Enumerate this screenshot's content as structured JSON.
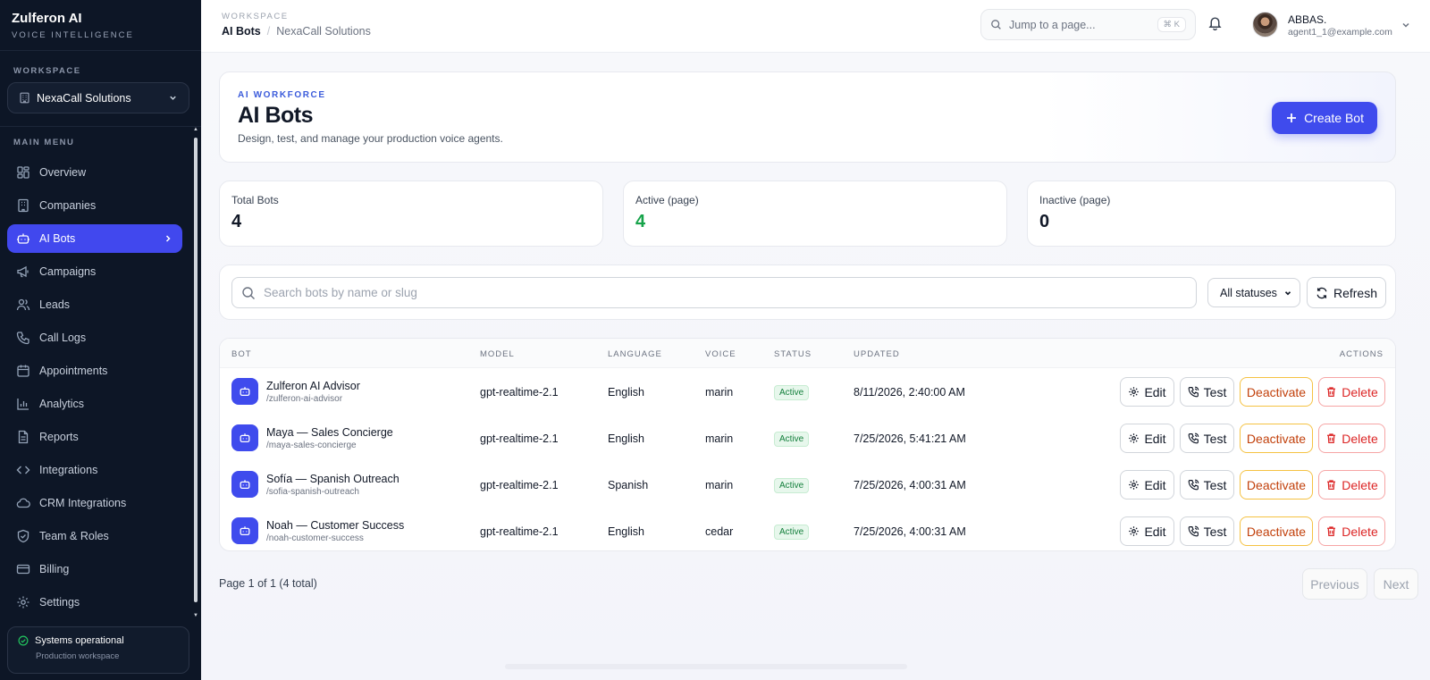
{
  "brand": {
    "name": "Zulferon AI",
    "subtitle": "VOICE INTELLIGENCE"
  },
  "workspace": {
    "label": "WORKSPACE",
    "selected": "NexaCall Solutions"
  },
  "menu": {
    "label": "MAIN MENU",
    "items": [
      {
        "label": "Overview",
        "icon": "overview-icon"
      },
      {
        "label": "Companies",
        "icon": "companies-icon"
      },
      {
        "label": "AI Bots",
        "icon": "bot-icon",
        "active": true
      },
      {
        "label": "Campaigns",
        "icon": "megaphone-icon"
      },
      {
        "label": "Leads",
        "icon": "users-icon"
      },
      {
        "label": "Call Logs",
        "icon": "phone-icon"
      },
      {
        "label": "Appointments",
        "icon": "calendar-icon"
      },
      {
        "label": "Analytics",
        "icon": "bar-chart-icon"
      },
      {
        "label": "Reports",
        "icon": "document-icon"
      },
      {
        "label": "Integrations",
        "icon": "code-icon"
      },
      {
        "label": "CRM Integrations",
        "icon": "cloud-icon"
      },
      {
        "label": "Team & Roles",
        "icon": "shield-icon"
      },
      {
        "label": "Billing",
        "icon": "credit-card-icon"
      },
      {
        "label": "Settings",
        "icon": "gear-icon"
      }
    ]
  },
  "system_status": {
    "title": "Systems operational",
    "subtitle": "Production workspace"
  },
  "topbar": {
    "crumb_label": "WORKSPACE",
    "crumb_current": "AI Bots",
    "crumb_separator": "/",
    "crumb_workspace": "NexaCall Solutions",
    "jump_placeholder": "Jump to a page...",
    "jump_shortcut": "⌘ K",
    "user_name": "ABBAS.",
    "user_email": "agent1_1@example.com"
  },
  "hero": {
    "eyebrow": "AI WORKFORCE",
    "title": "AI Bots",
    "description": "Design, test, and manage your production voice agents.",
    "create_label": "Create Bot"
  },
  "stats": [
    {
      "label": "Total Bots",
      "value": "4"
    },
    {
      "label": "Active (page)",
      "value": "4"
    },
    {
      "label": "Inactive (page)",
      "value": "0"
    }
  ],
  "filters": {
    "search_placeholder": "Search bots by name or slug",
    "status_selected": "All statuses",
    "refresh_label": "Refresh"
  },
  "table": {
    "headers": {
      "bot": "BOT",
      "model": "MODEL",
      "language": "LANGUAGE",
      "voice": "VOICE",
      "status": "STATUS",
      "updated": "UPDATED",
      "actions": "ACTIONS"
    },
    "action_labels": {
      "edit": "Edit",
      "test": "Test",
      "deactivate": "Deactivate",
      "delete": "Delete"
    },
    "rows": [
      {
        "name": "Zulferon AI Advisor",
        "slug": "/zulferon-ai-advisor",
        "model": "gpt-realtime-2.1",
        "language": "English",
        "voice": "marin",
        "status": "Active",
        "updated": "8/11/2026, 2:40:00 AM"
      },
      {
        "name": "Maya — Sales Concierge",
        "slug": "/maya-sales-concierge",
        "model": "gpt-realtime-2.1",
        "language": "English",
        "voice": "marin",
        "status": "Active",
        "updated": "7/25/2026, 5:41:21 AM"
      },
      {
        "name": "Sofía — Spanish Outreach",
        "slug": "/sofia-spanish-outreach",
        "model": "gpt-realtime-2.1",
        "language": "Spanish",
        "voice": "marin",
        "status": "Active",
        "updated": "7/25/2026, 4:00:31 AM"
      },
      {
        "name": "Noah — Customer Success",
        "slug": "/noah-customer-success",
        "model": "gpt-realtime-2.1",
        "language": "English",
        "voice": "cedar",
        "status": "Active",
        "updated": "7/25/2026, 4:00:31 AM"
      }
    ]
  },
  "pagination": {
    "summary": "Page 1 of 1 (4 total)",
    "previous": "Previous",
    "next": "Next"
  },
  "colors": {
    "accent": "#3f4bed",
    "sidebar_bg": "#0d1626",
    "active_green": "#16a34a",
    "warn": "#f5c242",
    "danger": "#dc2626"
  }
}
